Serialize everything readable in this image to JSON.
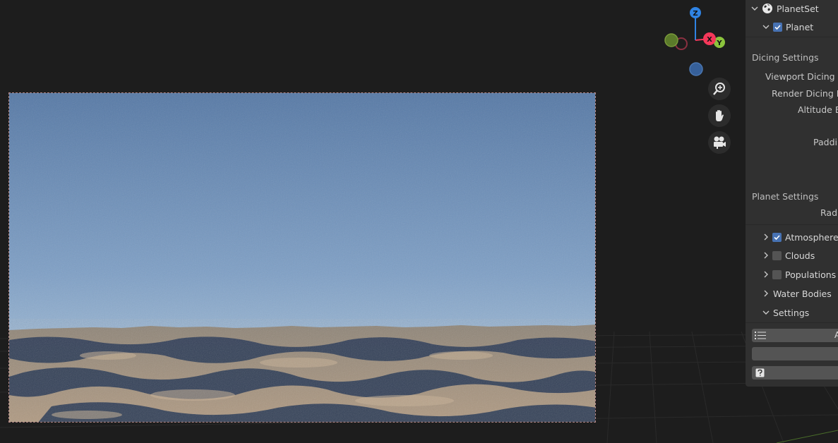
{
  "gizmo": {
    "z_label": "Z",
    "x_label": "X",
    "y_label": "Y"
  },
  "nav": {
    "zoom": "zoom-icon",
    "pan": "hand-icon",
    "camera": "camera-icon"
  },
  "outliner": {
    "root": {
      "label": "PlanetSet",
      "icon": "world-icon"
    },
    "planet": {
      "label": "Planet",
      "checked": true
    }
  },
  "dicing": {
    "section": "Dicing Settings",
    "viewport_label": "Viewport Dicing Ra",
    "render_label": "Render Dicing Ra",
    "altitude_label": "Altitude Bi",
    "padding_label": "Paddin"
  },
  "planet_settings": {
    "section": "Planet Settings",
    "radius_label": "Radi"
  },
  "subpanels": [
    {
      "label": "Atmosphere",
      "checked": true,
      "expanded": false
    },
    {
      "label": "Clouds",
      "checked": false,
      "expanded": false
    },
    {
      "label": "Populations",
      "checked": false,
      "expanded": false
    },
    {
      "label": "Water Bodies",
      "expanded": false
    },
    {
      "label": "Settings",
      "expanded": true
    }
  ],
  "settings_widgets": {
    "first_text": "A",
    "list_icon": "list-icon",
    "help_icon": "help-icon"
  },
  "colors": {
    "axis_x": "#f5385a",
    "axis_y": "#8bc43d",
    "axis_z": "#2f83e3",
    "checkbox_on": "#4772b3",
    "sky_top": "#5679a6",
    "sky_horizon": "#b9cfe0",
    "terrain": "#a6917a"
  }
}
